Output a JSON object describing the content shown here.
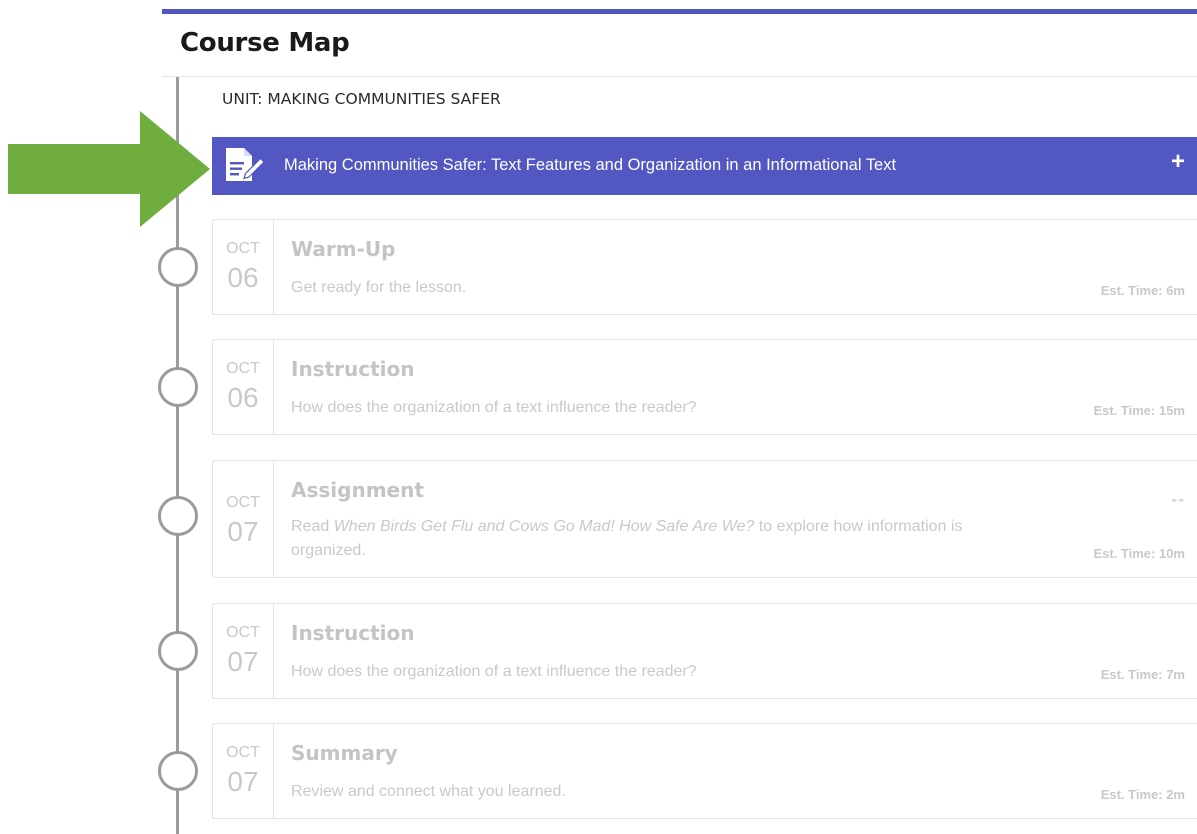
{
  "page": {
    "title": "Course Map"
  },
  "unit": {
    "title": "UNIT: MAKING COMMUNITIES SAFER"
  },
  "lesson": {
    "title": "Making Communities Safer: Text Features and Organization in an Informational Text",
    "icon": "document-edit-icon",
    "expand_label": "+",
    "bar_color": "#5257c2"
  },
  "annotation": {
    "icon": "green-arrow-icon",
    "color": "#6fad3f"
  },
  "activities": [
    {
      "month": "OCT",
      "day": "06",
      "title": "Warm-Up",
      "description": "Get ready for the lesson.",
      "est_time": "Est. Time: 6m"
    },
    {
      "month": "OCT",
      "day": "06",
      "title": "Instruction",
      "description": "How does the organization of a text influence the reader?",
      "est_time": "Est. Time: 15m"
    },
    {
      "month": "OCT",
      "day": "07",
      "title": "Assignment",
      "description_prefix": "Read ",
      "description_italic": "When Birds Get Flu and Cows Go Mad! How Safe Are We?",
      "description_suffix": " to explore how information is organized.",
      "extra": "--",
      "est_time": "Est. Time: 10m"
    },
    {
      "month": "OCT",
      "day": "07",
      "title": "Instruction",
      "description": "How does the organization of a text influence the reader?",
      "est_time": "Est. Time: 7m"
    },
    {
      "month": "OCT",
      "day": "07",
      "title": "Summary",
      "description": "Review and connect what you learned.",
      "est_time": "Est. Time: 2m"
    }
  ]
}
